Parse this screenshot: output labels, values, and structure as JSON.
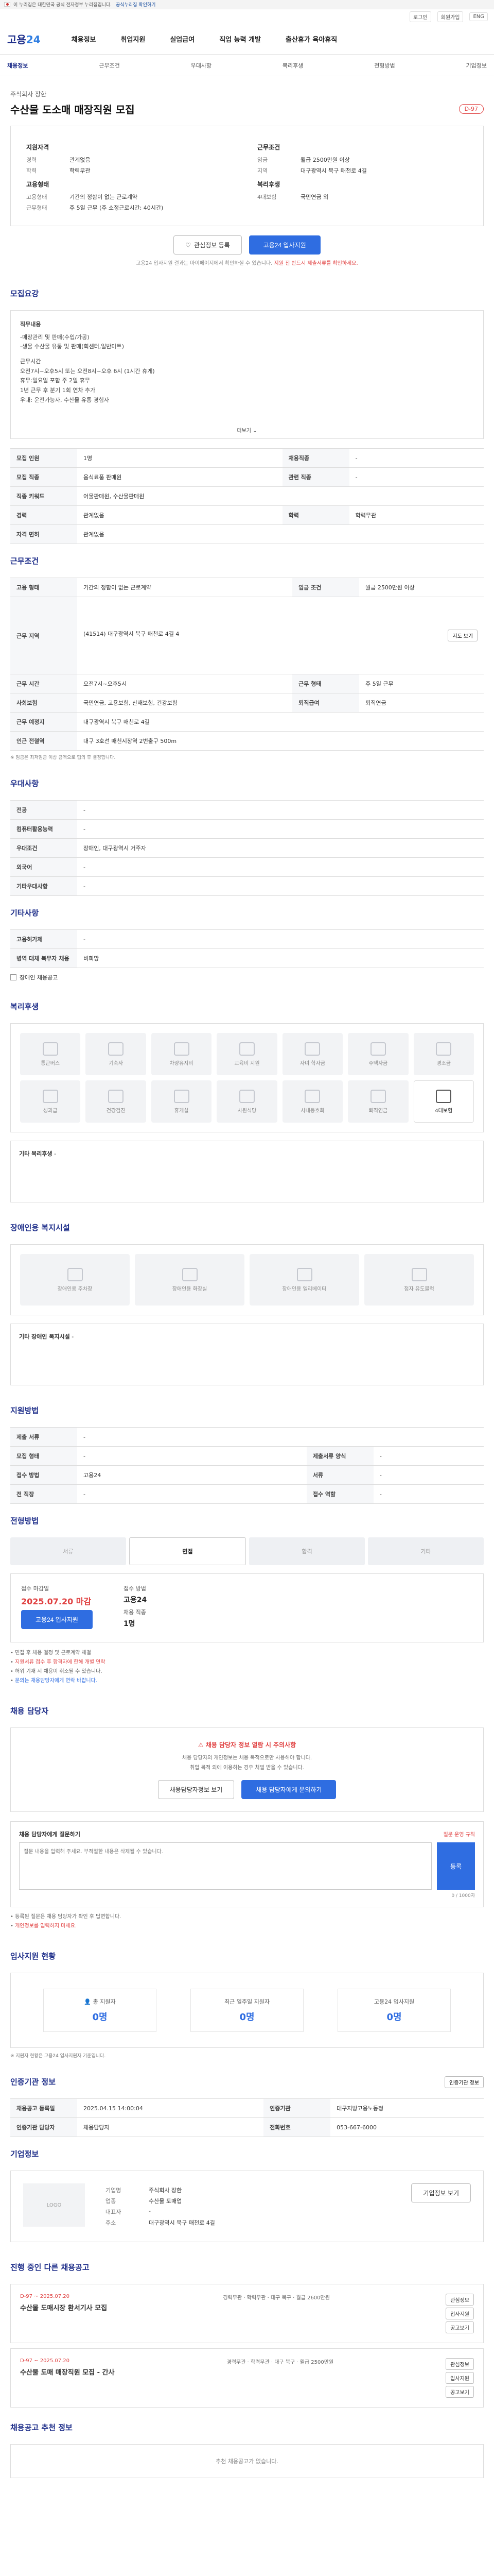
{
  "gov": {
    "text": "이 누리집은 대한민국 공식 전자정부 누리집입니다.",
    "toggle": "공식누리집 확인하기"
  },
  "topbar": {
    "login": "로그인",
    "signup": "회원가입",
    "lang": "ENG"
  },
  "header": {
    "logo1": "고용",
    "logo2": "24",
    "nav": [
      "채용정보",
      "취업지원",
      "실업급여",
      "직업 능력 개발",
      "출산휴가 육아휴직"
    ]
  },
  "subnav": [
    "채용정보",
    "근무조건",
    "우대사항",
    "복리후생",
    "전형방법",
    "기업정보"
  ],
  "job": {
    "company": "주식회사 장한",
    "title": "수산물 도소매 매장직원 모집",
    "dday": "D-97"
  },
  "summary": {
    "left_title": "지원자격",
    "left": [
      {
        "k": "경력",
        "v": "관계없음"
      },
      {
        "k": "학력",
        "v": "학력무관"
      }
    ],
    "left_title2": "고용형태",
    "left2": [
      {
        "k": "고용형태",
        "v": "기간의 정함이 없는 근로계약"
      },
      {
        "k": "근무형태",
        "v": "주 5일 근무 (주 소정근로시간: 40시간)"
      }
    ],
    "right_title": "근무조건",
    "right": [
      {
        "k": "임금",
        "v": "월급 2500만원 이상"
      },
      {
        "k": "지역",
        "v": "대구광역시 북구 매천로 4길"
      }
    ],
    "right_title2": "복리후생",
    "right2": [
      {
        "k": "4대보험",
        "v": "국민연금 외"
      }
    ]
  },
  "actions": {
    "like": "관심정보 등록",
    "apply": "고용24 입사지원"
  },
  "note1": "고용24 입사지원 결과는 마이페이지에서 확인하실 수 있습니다.",
  "note2": "지원 전 반드시 제출서류를 확인하세요.",
  "detail": {
    "title": "모집요강",
    "heading": "직무내용",
    "lines": [
      "-매장관리 및 판매(수입/가공)",
      "-생물 수산물 유통 및 판매(회센터,일반마트)",
      "근무시간",
      "오전7시~오후5시 또는 오전8시~오후 6시 (1시간 휴게)",
      "휴무:일요일 포함 주 2일 휴무",
      "1년 근무 후 분기 1회 연차 추가",
      "우대: 운전가능자, 수산물 유통 경험자"
    ],
    "more": "더보기"
  },
  "info1": [
    {
      "h": "모집 인원",
      "v": "1명",
      "h2": "채용직종",
      "v2": "-"
    },
    {
      "h": "모집 직종",
      "v": "음식료품 판매원",
      "h2": "관련 직종",
      "v2": "-"
    },
    {
      "h": "직종 키워드",
      "v": "어물판매원, 수산물판매원",
      "h2": "",
      "v2": ""
    },
    {
      "h": "경력",
      "v": "관계없음",
      "h2": "학력",
      "v2": "학력무관"
    },
    {
      "h": "자격 면허",
      "v": "관계없음",
      "h2": "",
      "v2": ""
    }
  ],
  "work": {
    "title": "근무조건",
    "rows": [
      {
        "h": "고용 형태",
        "v": "기간의 정함이 없는 근로계약",
        "h2": "임금 조건",
        "v2": "월급 2500만원 이상"
      },
      {
        "h": "근무 지역",
        "v": "(41514) 대구광역시 북구 매천로 4길 4",
        "h2": "",
        "v2": ""
      },
      {
        "h": "근무 시간",
        "v": "오전7시~오후5시",
        "h2": "근무 형태",
        "v2": "주 5일 근무"
      },
      {
        "h": "사회보험",
        "v": "국민연금, 고용보험, 산재보험, 건강보험",
        "h2": "퇴직급여",
        "v2": "퇴직연금"
      },
      {
        "h": "근무 예정지",
        "v": "대구광역시 북구 매천로 4길",
        "h2": "",
        "v2": ""
      },
      {
        "h": "인근 전철역",
        "v": "대구 3호선 매천시장역 2번출구 500m",
        "h2": "",
        "v2": ""
      }
    ],
    "map": "지도 보기",
    "foot": "※ 임금은 최저임금 이상 금액으로 협의 후 결정합니다."
  },
  "pref": {
    "title": "우대사항",
    "rows": [
      {
        "h": "전공",
        "v": "-"
      },
      {
        "h": "컴퓨터활용능력",
        "v": "-"
      },
      {
        "h": "우대조건",
        "v": "장애인, 대구광역시 거주자"
      },
      {
        "h": "외국어",
        "v": "-"
      },
      {
        "h": "기타우대사항",
        "v": "-"
      }
    ]
  },
  "other": {
    "title": "기타사항",
    "rows": [
      {
        "h": "고용허가제",
        "v": "-"
      },
      {
        "h": "병역 대체 복무자 채용",
        "v": "비희망"
      }
    ],
    "chk": "장애인 채용공고"
  },
  "benefit": {
    "title": "복리후생",
    "items": [
      "통근버스",
      "기숙사",
      "차량유지비",
      "교육비 지원",
      "자녀 학자금",
      "주택자금",
      "경조금",
      "성과급",
      "건강검진",
      "휴게실",
      "사원식당",
      "사내동호회",
      "퇴직연금"
    ],
    "active_idx": 13,
    "active": "4대보험",
    "box_label": "기타 복리후생",
    "box_val": "-"
  },
  "disab": {
    "title": "장애인용 복지시설",
    "items": [
      "장애인용 주차장",
      "장애인용 화장실",
      "장애인용 엘리베이터",
      "점자 유도블럭"
    ],
    "box_label": "기타 장애인 복지시설",
    "box_val": "-"
  },
  "apply": {
    "title": "지원방법",
    "rows": [
      {
        "h": "제출 서류",
        "v": "-"
      },
      {
        "h": "모집 형태",
        "v": "-",
        "h2": "제출서류 양식",
        "v2": "-"
      },
      {
        "h": "접수 방법",
        "v": "고용24",
        "h2": "서류",
        "v2": "-"
      },
      {
        "h": "전 직장",
        "v": "-",
        "h2": "접수 역할",
        "v2": "-"
      }
    ]
  },
  "steps": {
    "title": "전형방법",
    "items": [
      "서류",
      "면접",
      "합격",
      "기타"
    ],
    "on": 1
  },
  "period": {
    "start_label": "접수 마감일",
    "start": "2025.07.20 마감",
    "apply": "고용24 입사지원",
    "end_label": "접수 방법",
    "end": "고용24",
    "count_label": "채용 직종",
    "count": "1명"
  },
  "bul": [
    "면접 후 채용 결정 및 근로계약 체결",
    "지원서류 접수 후 합격자에 한해 개별 연락",
    "허위 기재 시 채용이 취소될 수 있습니다.",
    "문의는 채용담당자에게 연락 바랍니다."
  ],
  "manager": {
    "title": "채용 담당자",
    "warn": "채용 담당자 정보 열람 시 주의사항",
    "s1": "채용 담당자의 개인정보는 채용 목적으로만 사용해야 합니다.",
    "s2": "취업 목적 외에 이용하는 경우 처벌 받을 수 있습니다.",
    "b1": "채용담당자정보 보기",
    "b2": "채용 담당자에게 문의하기"
  },
  "qna": {
    "title": "채용 담당자에게 질문하기",
    "right": "질문 운영 규칙",
    "placeholder": "질문 내용을 입력해 주세요. 부적절한 내용은 삭제될 수 있습니다.",
    "send": "등록",
    "cnt": "0 / 1000자",
    "n1": "등록된 질문은 채용 담당자가 확인 후 답변합니다.",
    "n2": "개인정보를 입력하지 마세요."
  },
  "stats": {
    "title": "입사지원 현황",
    "items": [
      {
        "n": "총 지원자",
        "c": "0명"
      },
      {
        "n": "최근 일주일 지원자",
        "c": "0명"
      },
      {
        "n": "고용24 입사지원",
        "c": "0명"
      }
    ],
    "note": "※ 지원자 현황은 고용24 입사지원자 기준입니다."
  },
  "reg": {
    "title": "인증기관 정보",
    "rows": [
      {
        "h": "채용공고 등록일",
        "v": "2025.04.15 14:00:04",
        "h2": "인증기관",
        "v2": "대구지방고용노동청"
      },
      {
        "h": "인증기관 담당자",
        "v": "채용담당자",
        "h2": "전화번호",
        "v2": "053-667-6000"
      }
    ],
    "btn": "인증기관 정보"
  },
  "corp": {
    "title": "기업정보",
    "logo": "LOGO",
    "rows": [
      {
        "k": "기업명",
        "v": "주식회사 장한"
      },
      {
        "k": "업종",
        "v": "수산물 도매업"
      },
      {
        "k": "대표자",
        "v": "-"
      },
      {
        "k": "주소",
        "v": "대구광역시 북구 매천로 4길"
      }
    ],
    "btn": "기업정보 보기"
  },
  "other_jobs": {
    "title": "진행 중인 다른 채용공고",
    "jobs": [
      {
        "dt": "D-97 ~ 2025.07.20",
        "nm": "수산물 도매시장 환서기사 모집",
        "m": "경력무관 · 학력무관 · 대구 북구 · 월급 2600만원"
      },
      {
        "dt": "D-97 ~ 2025.07.20",
        "nm": "수산물 도매 매장직원 모집 - 간사",
        "m": "경력무관 · 학력무관 · 대구 북구 · 월급 2500만원"
      }
    ],
    "b": [
      "관심정보",
      "입사지원",
      "공고보기"
    ]
  },
  "recommend": {
    "title": "채용공고 추천 정보",
    "text": "추천 채용공고가 없습니다."
  }
}
